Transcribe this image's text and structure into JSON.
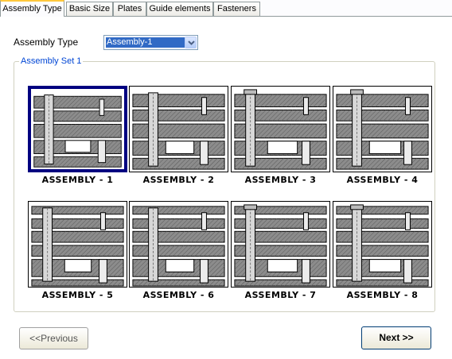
{
  "tabs": [
    {
      "label": "Assembly Type",
      "active": true
    },
    {
      "label": "Basic Size",
      "active": false
    },
    {
      "label": "Plates",
      "active": false
    },
    {
      "label": "Guide elements",
      "active": false
    },
    {
      "label": "Fasteners",
      "active": false
    }
  ],
  "assembly_type": {
    "label": "Assembly Type",
    "selected": "Assembly-1"
  },
  "group": {
    "title": "Assembly Set 1",
    "items": [
      {
        "caption": "ASSEMBLY - 1",
        "selected": true
      },
      {
        "caption": "ASSEMBLY - 2",
        "selected": false
      },
      {
        "caption": "ASSEMBLY - 3",
        "selected": false
      },
      {
        "caption": "ASSEMBLY - 4",
        "selected": false
      },
      {
        "caption": "ASSEMBLY - 5",
        "selected": false
      },
      {
        "caption": "ASSEMBLY - 6",
        "selected": false
      },
      {
        "caption": "ASSEMBLY - 7",
        "selected": false
      },
      {
        "caption": "ASSEMBLY - 8",
        "selected": false
      }
    ]
  },
  "buttons": {
    "previous": "<<Previous",
    "next": "Next >>"
  },
  "colors": {
    "tab_active_accent": "#ffc83c",
    "selection": "#316ac5",
    "selected_tile_border": "#000080",
    "group_title": "#0046d5",
    "plate": "#8c8c8c"
  }
}
